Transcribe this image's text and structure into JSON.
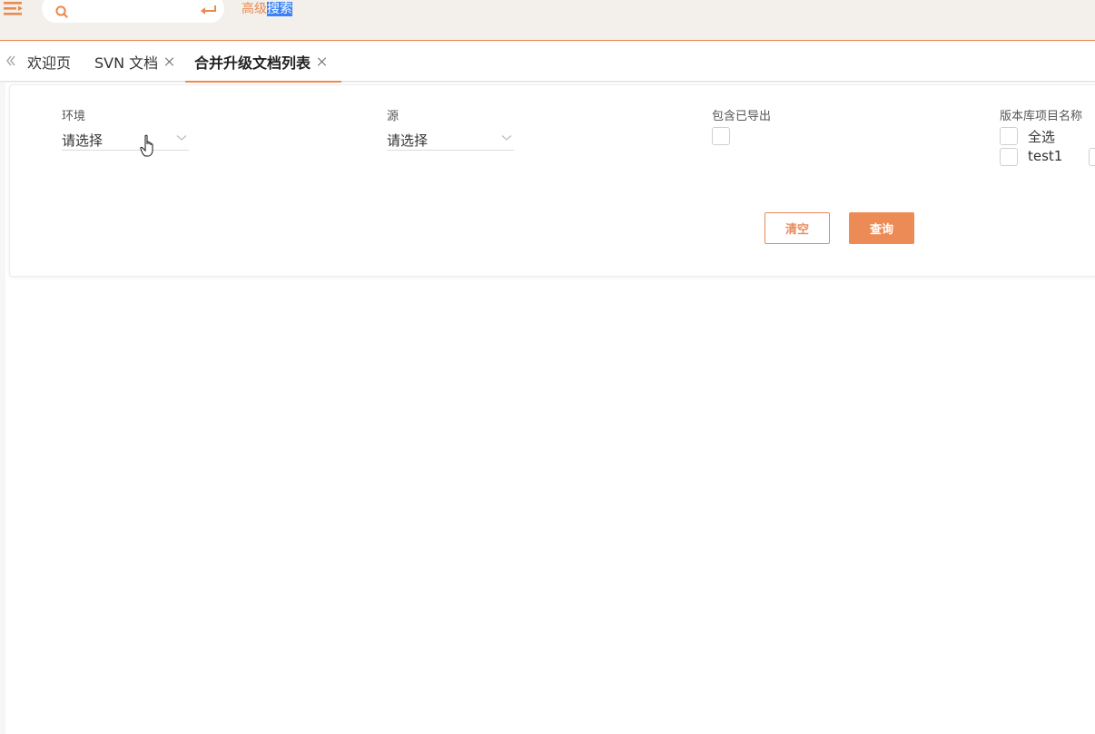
{
  "header": {
    "search": {
      "value": "",
      "placeholder": ""
    },
    "advanced_search": {
      "part1": "高级",
      "part2": "搜索"
    }
  },
  "tabs": [
    {
      "label": "欢迎页",
      "closable": false
    },
    {
      "label": "SVN 文档",
      "closable": true
    },
    {
      "label": "合并升级文档列表",
      "closable": true,
      "active": true
    }
  ],
  "filters": {
    "env": {
      "label": "环境",
      "value": "请选择"
    },
    "source": {
      "label": "源",
      "value": "请选择"
    },
    "include_exported": {
      "label": "包含已导出"
    },
    "repo_project": {
      "label": "版本库项目名称",
      "options": [
        "全选",
        "test1"
      ]
    }
  },
  "buttons": {
    "clear": "清空",
    "query": "查询"
  },
  "colors": {
    "accent": "#ec8a4f",
    "selection": "#3b82f6"
  }
}
